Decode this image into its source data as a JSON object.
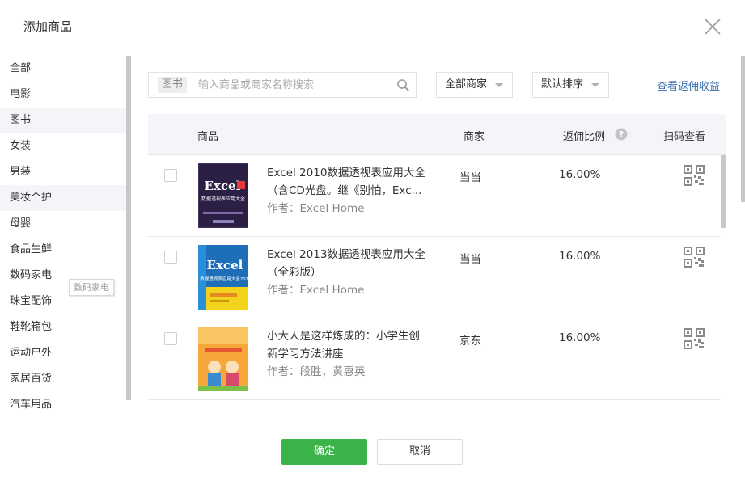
{
  "dialog": {
    "title": "添加商品"
  },
  "sidebar": {
    "items": [
      {
        "label": "全部"
      },
      {
        "label": "电影"
      },
      {
        "label": "图书"
      },
      {
        "label": "女装"
      },
      {
        "label": "男装"
      },
      {
        "label": "美妆个护"
      },
      {
        "label": "母婴"
      },
      {
        "label": "食品生鲜"
      },
      {
        "label": "数码家电"
      },
      {
        "label": "珠宝配饰"
      },
      {
        "label": "鞋靴箱包"
      },
      {
        "label": "运动户外"
      },
      {
        "label": "家居百货"
      },
      {
        "label": "汽车用品"
      }
    ],
    "active_index": 2,
    "tooltip": "数码家电"
  },
  "search": {
    "category_tag": "图书",
    "placeholder": "输入商品或商家名称搜索",
    "value": ""
  },
  "filters": {
    "merchant_label": "全部商家",
    "sort_label": "默认排序"
  },
  "earnings_link": "查看返佣收益",
  "table": {
    "headers": {
      "product": "商品",
      "merchant": "商家",
      "ratio": "返佣比例",
      "qr": "扫码查看"
    },
    "rows": [
      {
        "title_line1": "Excel 2010数据透视表应用大全",
        "title_line2": "（含CD光盘。继《别怕，Exc...",
        "author": "作者：Excel Home",
        "merchant": "当当",
        "ratio": "16.00%",
        "cover_text_main": "Excel",
        "cover_text_sub": "数据透视表应用大全"
      },
      {
        "title_line1": "Excel 2013数据透视表应用大全",
        "title_line2": "（全彩版）",
        "author": "作者：Excel Home",
        "merchant": "当当",
        "ratio": "16.00%",
        "cover_text_main": "Excel",
        "cover_text_sub": "数据透视表应用大全2013"
      },
      {
        "title_line1": "小大人是这样炼成的：小学生创",
        "title_line2": "新学习方法讲座",
        "author": "作者：段胜，黄惠英",
        "merchant": "京东",
        "ratio": "16.00%",
        "cover_text_main": "",
        "cover_text_sub": ""
      }
    ]
  },
  "footer": {
    "ok_label": "确定",
    "cancel_label": "取消"
  },
  "colors": {
    "primary_green": "#3bb34a",
    "link_blue": "#3a6fb0",
    "header_bg": "#f4f5f9"
  }
}
